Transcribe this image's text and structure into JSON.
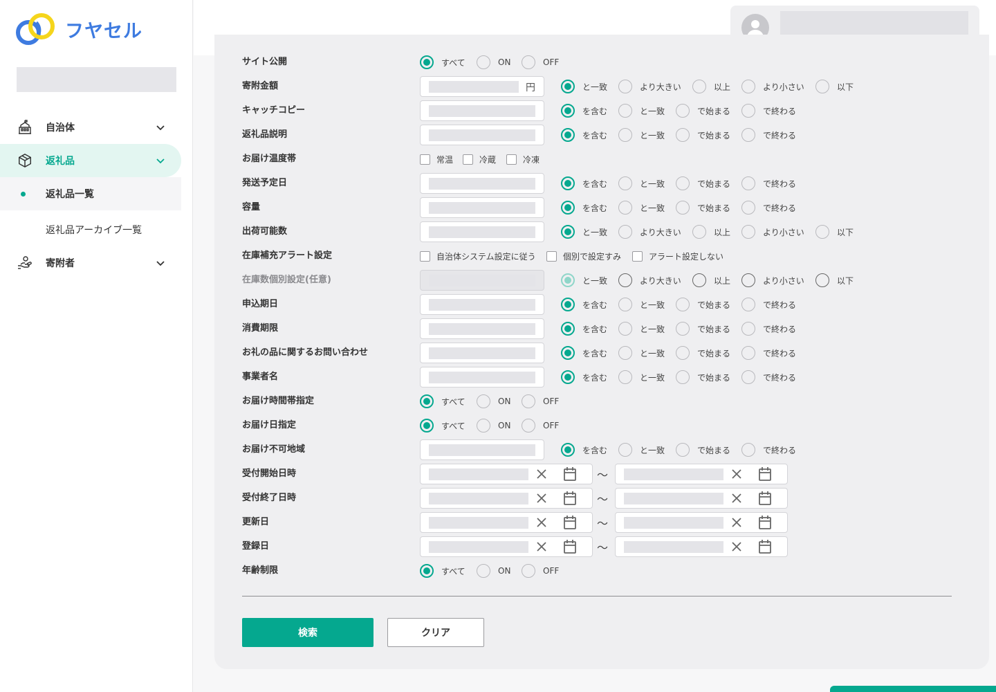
{
  "app": {
    "logo_text": "フヤセル"
  },
  "sidebar": {
    "items": [
      {
        "label": "自治体"
      },
      {
        "label": "返礼品"
      },
      {
        "label": "寄附者"
      }
    ],
    "sub_items": [
      {
        "label": "返礼品一覧"
      },
      {
        "label": "返礼品アーカイブ一覧"
      }
    ]
  },
  "options": {
    "publish": [
      "すべて",
      "ON",
      "OFF"
    ],
    "numeric": [
      "と一致",
      "より大きい",
      "以上",
      "より小さい",
      "以下"
    ],
    "text": [
      "を含む",
      "と一致",
      "で始まる",
      "で終わる"
    ],
    "temperature": [
      "常温",
      "冷蔵",
      "冷凍"
    ],
    "stock_alert": [
      "自治体システム設定に従う",
      "個別で設定すみ",
      "アラート設定しない"
    ],
    "yen": "円",
    "tilde": "〜"
  },
  "form": {
    "labels": [
      "サイト公開",
      "寄附金額",
      "キャッチコピー",
      "返礼品説明",
      "お届け温度帯",
      "発送予定日",
      "容量",
      "出荷可能数",
      "在庫補充アラート設定",
      "在庫数個別設定(任意)",
      "申込期日",
      "消費期限",
      "お礼の品に関するお問い合わせ",
      "事業者名",
      "お届け時間帯指定",
      "お届け日指定",
      "お届け不可地域",
      "受付開始日時",
      "受付終了日時",
      "更新日",
      "登録日",
      "年齢制限"
    ]
  },
  "buttons": {
    "search": "検索",
    "clear": "クリア"
  },
  "colors": {
    "accent": "#05a88f",
    "logo_blue": "#3e7be0",
    "logo_yellow": "#f5d51c"
  }
}
